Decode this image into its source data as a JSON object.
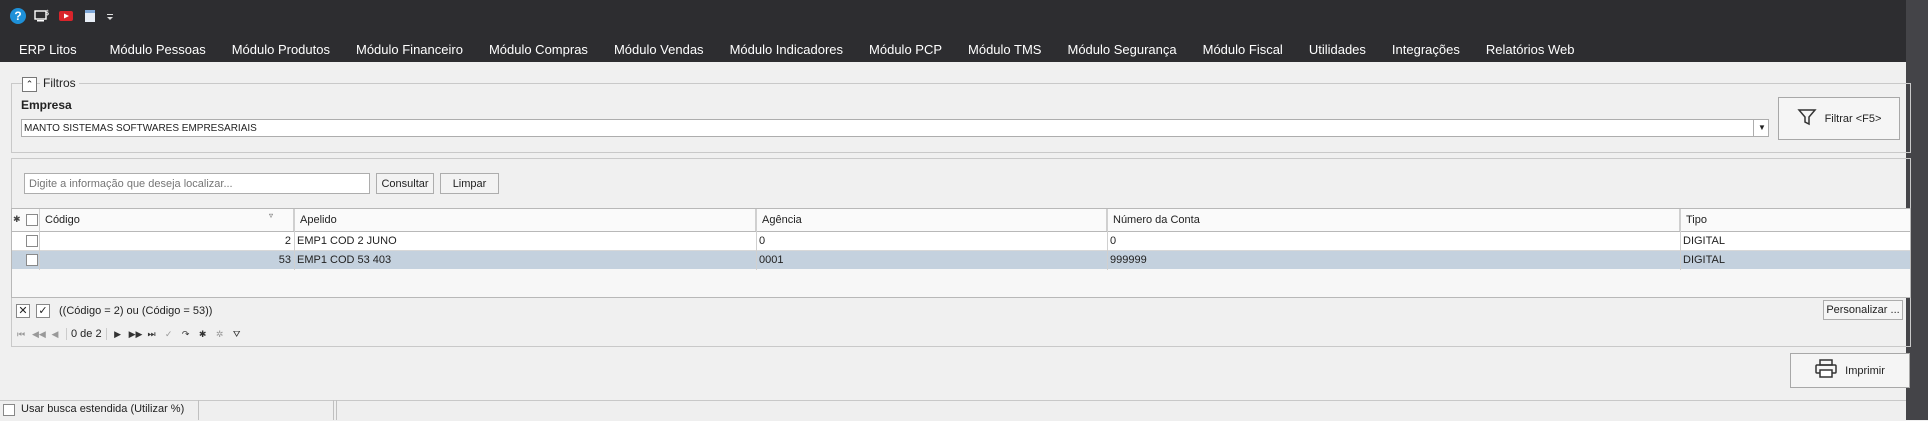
{
  "menu": [
    "ERP Litos",
    "Módulo Pessoas",
    "Módulo Produtos",
    "Módulo Financeiro",
    "Módulo Compras",
    "Módulo Vendas",
    "Módulo Indicadores",
    "Módulo PCP",
    "Módulo TMS",
    "Módulo Segurança",
    "Módulo Fiscal",
    "Utilidades",
    "Integrações",
    "Relatórios Web"
  ],
  "filtros": {
    "title": "Filtros",
    "empresa_label": "Empresa",
    "empresa_value": "MANTO SISTEMAS SOFTWARES EMPRESARIAIS",
    "filtrar_label": "Filtrar <F5>"
  },
  "search": {
    "placeholder": "Digite a informação que deseja localizar...",
    "consultar_label": "Consultar",
    "limpar_label": "Limpar"
  },
  "grid": {
    "columns": [
      "Código",
      "Apelido",
      "Agência",
      "Número da Conta",
      "Tipo"
    ],
    "rows": [
      {
        "codigo": "2",
        "apelido": "EMP1 COD 2 JUNO",
        "agencia": "0",
        "conta": "0",
        "tipo": "DIGITAL"
      },
      {
        "codigo": "53",
        "apelido": "EMP1 COD 53 403",
        "agencia": "0001",
        "conta": "999999",
        "tipo": "DIGITAL"
      }
    ]
  },
  "filter_expression": "((Código = 2) ou (Código = 53))",
  "personalizar_label": "Personalizar ...",
  "navigator": {
    "page_text": "0 de 2"
  },
  "imprimir_label": "Imprimir",
  "status": {
    "busca_estendida_label": "Usar busca estendida (Utilizar %)"
  },
  "colors": {
    "titlebar": "#2d2d30",
    "selected_row": "#c4d1de",
    "help_icon": "#1e90d8"
  }
}
